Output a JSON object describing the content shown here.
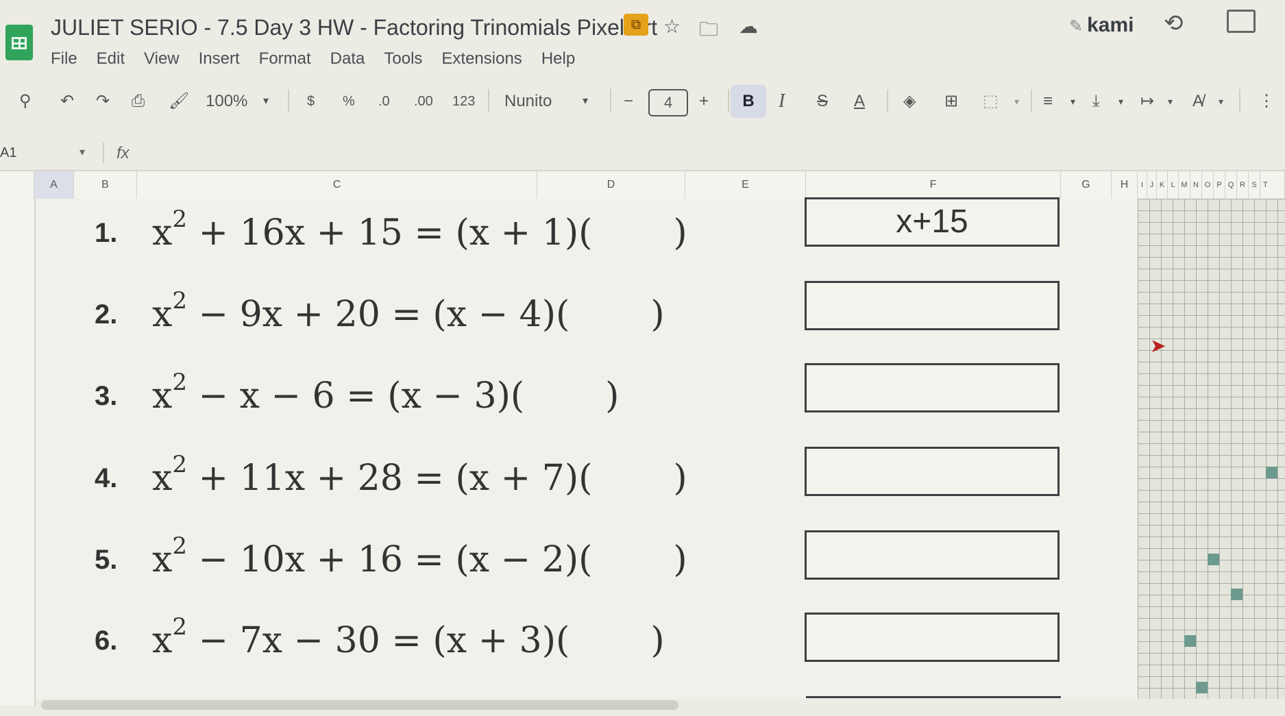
{
  "app": {
    "title": "JULIET SERIO - 7.5 Day 3 HW - Factoring Trinomials Pixel Art",
    "kami_label": "kami"
  },
  "menu": [
    "File",
    "Edit",
    "View",
    "Insert",
    "Format",
    "Data",
    "Tools",
    "Extensions",
    "Help"
  ],
  "toolbar": {
    "zoom": "100%",
    "currency": "$",
    "percent": "%",
    "decrease_decimal": ".0",
    "increase_decimal": ".00",
    "number_format": "123",
    "font": "Nunito",
    "font_size": "4",
    "minus": "−",
    "plus": "+",
    "bold": "B",
    "italic": "I"
  },
  "formula_bar": {
    "cell_ref": "A1",
    "fx": "fx"
  },
  "columns": [
    "A",
    "B",
    "C",
    "D",
    "E",
    "F",
    "G",
    "H",
    "I",
    "J",
    "K",
    "L",
    "M",
    "N",
    "O",
    "P",
    "Q",
    "R",
    "S",
    "T"
  ],
  "problems": [
    {
      "num": "1.",
      "lhs_a": "x",
      "sup": "2",
      "lhs_b": " + 16x + 15 = (x + 1)(",
      "close": ")",
      "answer": "x+15"
    },
    {
      "num": "2.",
      "lhs_a": "x",
      "sup": "2",
      "lhs_b": " − 9x + 20 = (x − 4)(",
      "close": ")",
      "answer": ""
    },
    {
      "num": "3.",
      "lhs_a": "x",
      "sup": "2",
      "lhs_b": " − x − 6 = (x − 3)(",
      "close": ")",
      "answer": ""
    },
    {
      "num": "4.",
      "lhs_a": "x",
      "sup": "2",
      "lhs_b": " + 11x + 28 = (x + 7)(",
      "close": ")",
      "answer": ""
    },
    {
      "num": "5.",
      "lhs_a": "x",
      "sup": "2",
      "lhs_b": " − 10x + 16 = (x − 2)(",
      "close": ")",
      "answer": ""
    },
    {
      "num": "6.",
      "lhs_a": "x",
      "sup": "2",
      "lhs_b": " − 7x − 30 = (x + 3)(",
      "close": ")",
      "answer": ""
    }
  ],
  "colors": {
    "sheets_green": "#2fa45a",
    "pixel_fill": "#6d9a8e",
    "page_bg": "#ecebe4"
  }
}
